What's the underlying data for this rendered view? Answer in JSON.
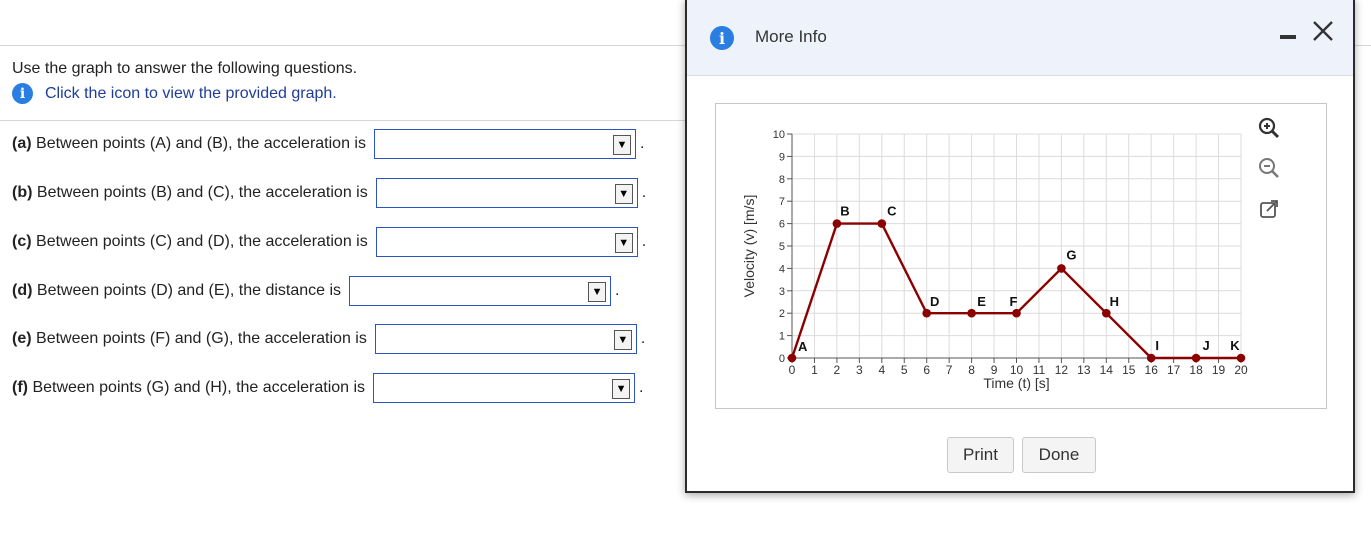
{
  "prompt": {
    "intro": "Use the graph to answer the following questions.",
    "hint": "Click the icon to view the provided graph."
  },
  "questions": [
    {
      "letter": "(a)",
      "text": "Between points (A) and (B), the acceleration is",
      "value": ""
    },
    {
      "letter": "(b)",
      "text": "Between points (B) and (C), the acceleration is",
      "value": ""
    },
    {
      "letter": "(c)",
      "text": "Between points (C) and (D), the acceleration is",
      "value": ""
    },
    {
      "letter": "(d)",
      "text": "Between points (D) and (E), the distance is",
      "value": ""
    },
    {
      "letter": "(e)",
      "text": "Between points (F) and (G), the acceleration is",
      "value": ""
    },
    {
      "letter": "(f)",
      "text": "Between points (G) and (H), the acceleration is",
      "value": ""
    }
  ],
  "dropdown_arrow": "▼",
  "modal": {
    "title": "More Info",
    "info_glyph": "i",
    "print_label": "Print",
    "done_label": "Done",
    "icons": [
      "zoom-in-icon",
      "zoom-out-icon",
      "open-external-icon",
      "minimize-icon",
      "close-icon"
    ]
  },
  "colors": {
    "accent": "#2a7de1",
    "plot_line": "#8b0000",
    "select_border": "#2a54c4"
  },
  "chart_data": {
    "type": "line",
    "xlabel": "Time (t) [s]",
    "ylabel": "Velocity (v) [m/s]",
    "xlim": [
      0,
      20
    ],
    "ylim": [
      0,
      10
    ],
    "x_ticks": [
      0,
      1,
      2,
      3,
      4,
      5,
      6,
      7,
      8,
      9,
      10,
      11,
      12,
      13,
      14,
      15,
      16,
      17,
      18,
      19,
      20
    ],
    "y_ticks": [
      0,
      1,
      2,
      3,
      4,
      5,
      6,
      7,
      8,
      9,
      10
    ],
    "grid": true,
    "series": [
      {
        "x": [
          0,
          2,
          4,
          6,
          8,
          10,
          12,
          14,
          16,
          18,
          20
        ],
        "y": [
          0,
          6,
          6,
          2,
          2,
          2,
          4,
          2,
          0,
          0,
          0
        ],
        "point_labels": [
          "A",
          "B",
          "C",
          "D",
          "E",
          "F",
          "G",
          "H",
          "I",
          "J",
          "K"
        ]
      }
    ]
  }
}
